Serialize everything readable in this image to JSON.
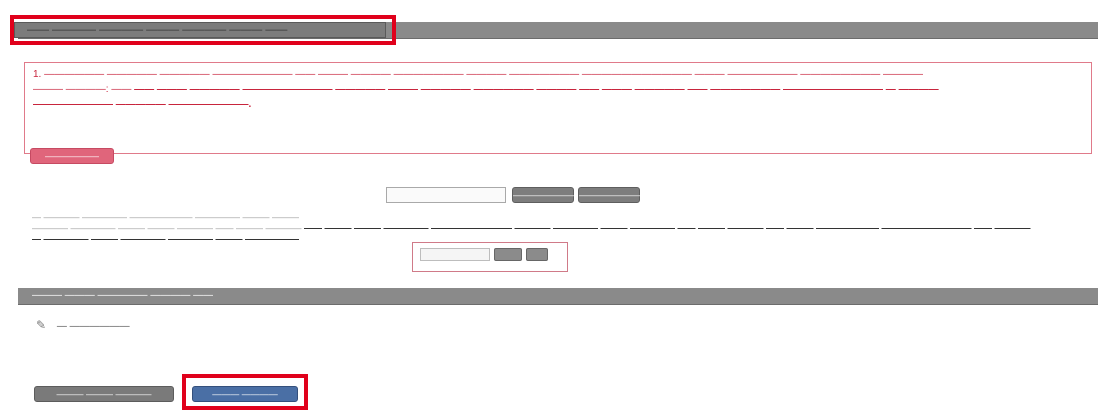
{
  "section1": {
    "title": "—— ———— ———— ——— ———— ——— ——"
  },
  "notice": {
    "line1": "1. —————— ————— ————— ———————— —— ——— ———— ——————— ———— ——————— ——————————— ——— ——————— ———————— ————",
    "line2_a": "——— ————: ——",
    "line2_b": "—— ——— ————— ————————— ————— ——— ————— —————— ———— —— ——— ————— —— ——————— —————————— — ————",
    "line3": "———————— ————— ————————."
  },
  "pink_button": {
    "label": "——————"
  },
  "upload": {
    "input_value": "",
    "btn1": "———————",
    "btn2": "———————"
  },
  "info": {
    "line1": "— ———— ————— ——————— ————— ——— ———",
    "line2_a": "———— ————— ——— ——— ———— —— ——— ————",
    "line2_b": "—— ——— ——— ————— ————————— ———— ————— ——— ————— —— ——— ———— —— ——— ——————— —————————— —— ————",
    "line3": "— ————— ——— ————— ————— ——— ——————"
  },
  "mini_form": {
    "input_value": "",
    "btn1": "",
    "btn2": ""
  },
  "section2": {
    "title": "——— ——— ————— ———— ——"
  },
  "file_item": {
    "label": "— ——————"
  },
  "bottom": {
    "btn1": "——— ——— ————",
    "btn2": "——— ————"
  },
  "colors": {
    "accent_red": "#e0001b",
    "notice_text": "#c8253d",
    "bar_gray": "#8a8a8a",
    "pink_button": "#e0657b",
    "primary_blue": "#4a6fa5"
  },
  "icons": {
    "file_item": "pencil-icon"
  }
}
